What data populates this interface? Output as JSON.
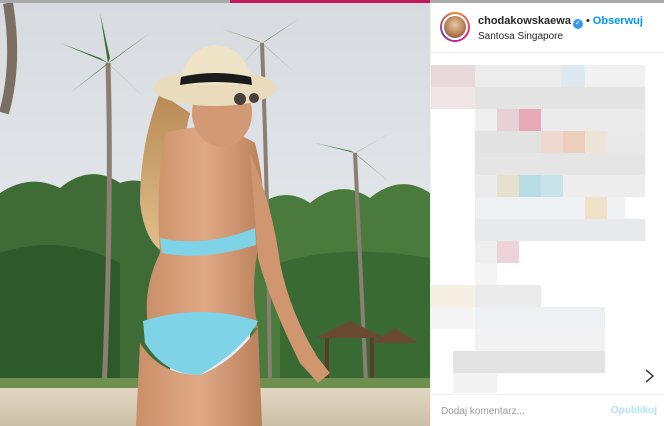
{
  "post": {
    "username": "chodakowskaewa",
    "verified_icon": "verified-badge-icon",
    "separator": "•",
    "follow_label": "Obserwuj",
    "location": "Santosa Singapore",
    "image_icon": "beach-photo"
  },
  "comment_box": {
    "placeholder": "Dodaj komentarz...",
    "publish_label": "Opublikuj"
  },
  "colors": {
    "accent": "#c2185b",
    "link": "#0095f6",
    "publish_disabled": "#b2dffc",
    "bikini": "#7fd3e6"
  }
}
